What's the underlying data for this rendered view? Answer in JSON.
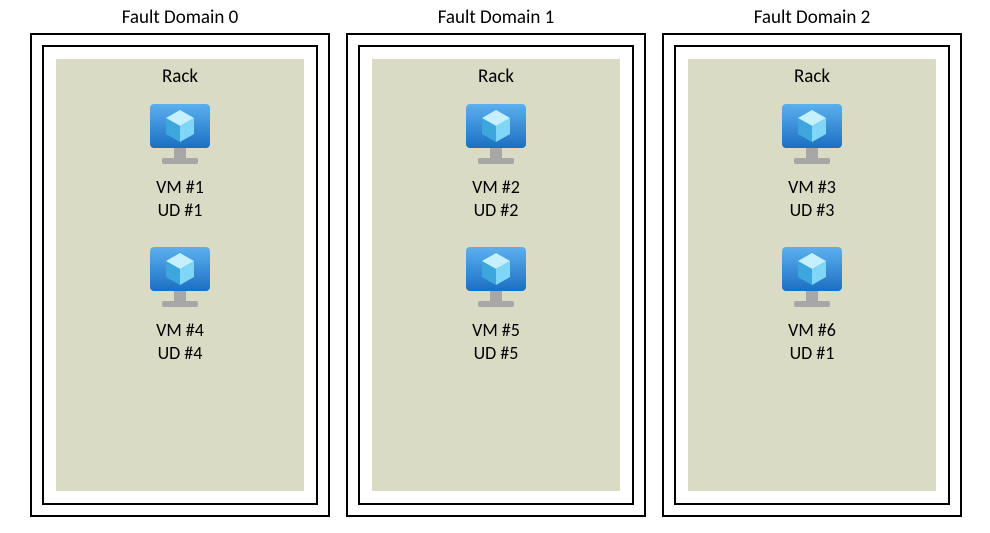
{
  "faultDomains": [
    {
      "title": "Fault Domain 0",
      "rackLabel": "Rack",
      "vms": [
        {
          "vmLabel": "VM #1",
          "udLabel": "UD #1"
        },
        {
          "vmLabel": "VM #4",
          "udLabel": "UD #4"
        }
      ]
    },
    {
      "title": "Fault Domain 1",
      "rackLabel": "Rack",
      "vms": [
        {
          "vmLabel": "VM #2",
          "udLabel": "UD #2"
        },
        {
          "vmLabel": "VM #5",
          "udLabel": "UD #5"
        }
      ]
    },
    {
      "title": "Fault Domain 2",
      "rackLabel": "Rack",
      "vms": [
        {
          "vmLabel": "VM #3",
          "udLabel": "UD #3"
        },
        {
          "vmLabel": "VM #6",
          "udLabel": "UD #1"
        }
      ]
    }
  ],
  "colors": {
    "rackFill": "#d9dbc4",
    "monitorBlueTop": "#5cb0ef",
    "monitorBlueBottom": "#1b6fc2",
    "cubeLight": "#c4f0ff",
    "cubeMid": "#7fd6f6",
    "cubeDeep": "#3da7dd",
    "stand": "#a7a7a7"
  }
}
